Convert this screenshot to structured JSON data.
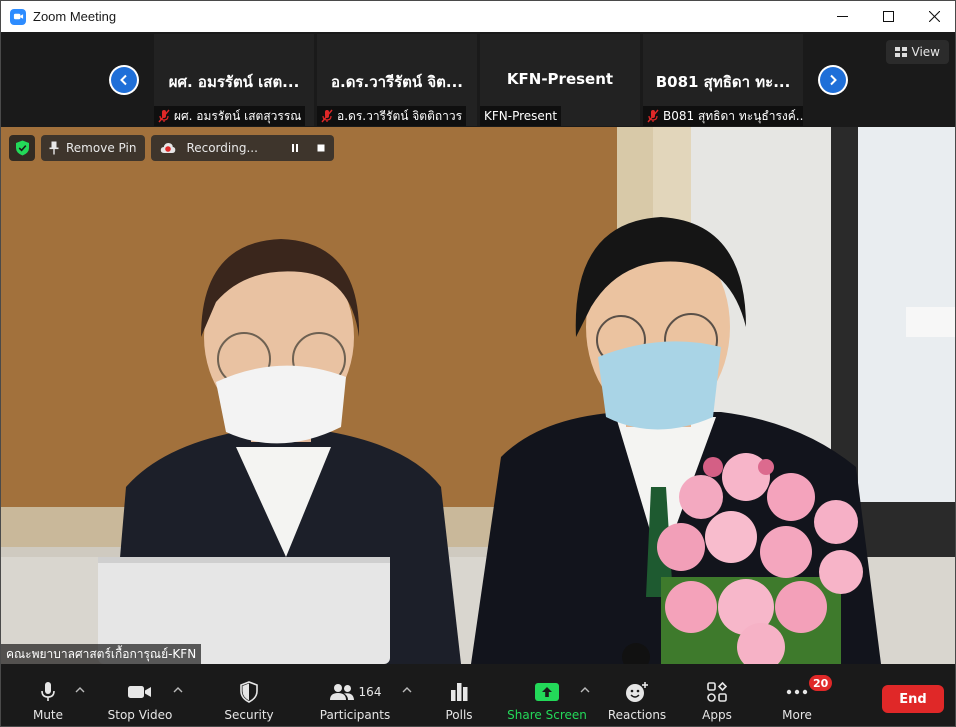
{
  "window": {
    "title": "Zoom Meeting"
  },
  "gallery": {
    "view_label": "View",
    "tiles": [
      {
        "display_name": "ผศ. อมรรัตน์  เสต...",
        "label": "ผศ. อมรรัตน์  เสตสุวรรณ",
        "muted": true
      },
      {
        "display_name": "อ.ดร.วารีรัตน์ จิต...",
        "label": "อ.ดร.วารีรัตน์ จิตติถาวร",
        "muted": true
      },
      {
        "display_name": "KFN-Present",
        "label": "KFN-Present",
        "muted": false
      },
      {
        "display_name": "B081 สุทธิดา ทะ...",
        "label": "B081 สุทธิดา ทะนุธำรงค์...",
        "muted": true
      }
    ]
  },
  "video": {
    "remove_pin_label": "Remove Pin",
    "recording_label": "Recording...",
    "speaker_name": "คณะพยาบาลศาสตร์เกื้อการุณย์-KFN"
  },
  "toolbar": {
    "mute_label": "Mute",
    "stop_video_label": "Stop Video",
    "security_label": "Security",
    "participants_label": "Participants",
    "participants_count": "164",
    "polls_label": "Polls",
    "share_screen_label": "Share Screen",
    "reactions_label": "Reactions",
    "apps_label": "Apps",
    "more_label": "More",
    "more_badge": "20",
    "end_label": "End"
  },
  "colors": {
    "accent_blue": "#2d8cff",
    "share_green": "#23d959",
    "end_red": "#e02828",
    "toolbar_bg": "#1a1a1a"
  }
}
